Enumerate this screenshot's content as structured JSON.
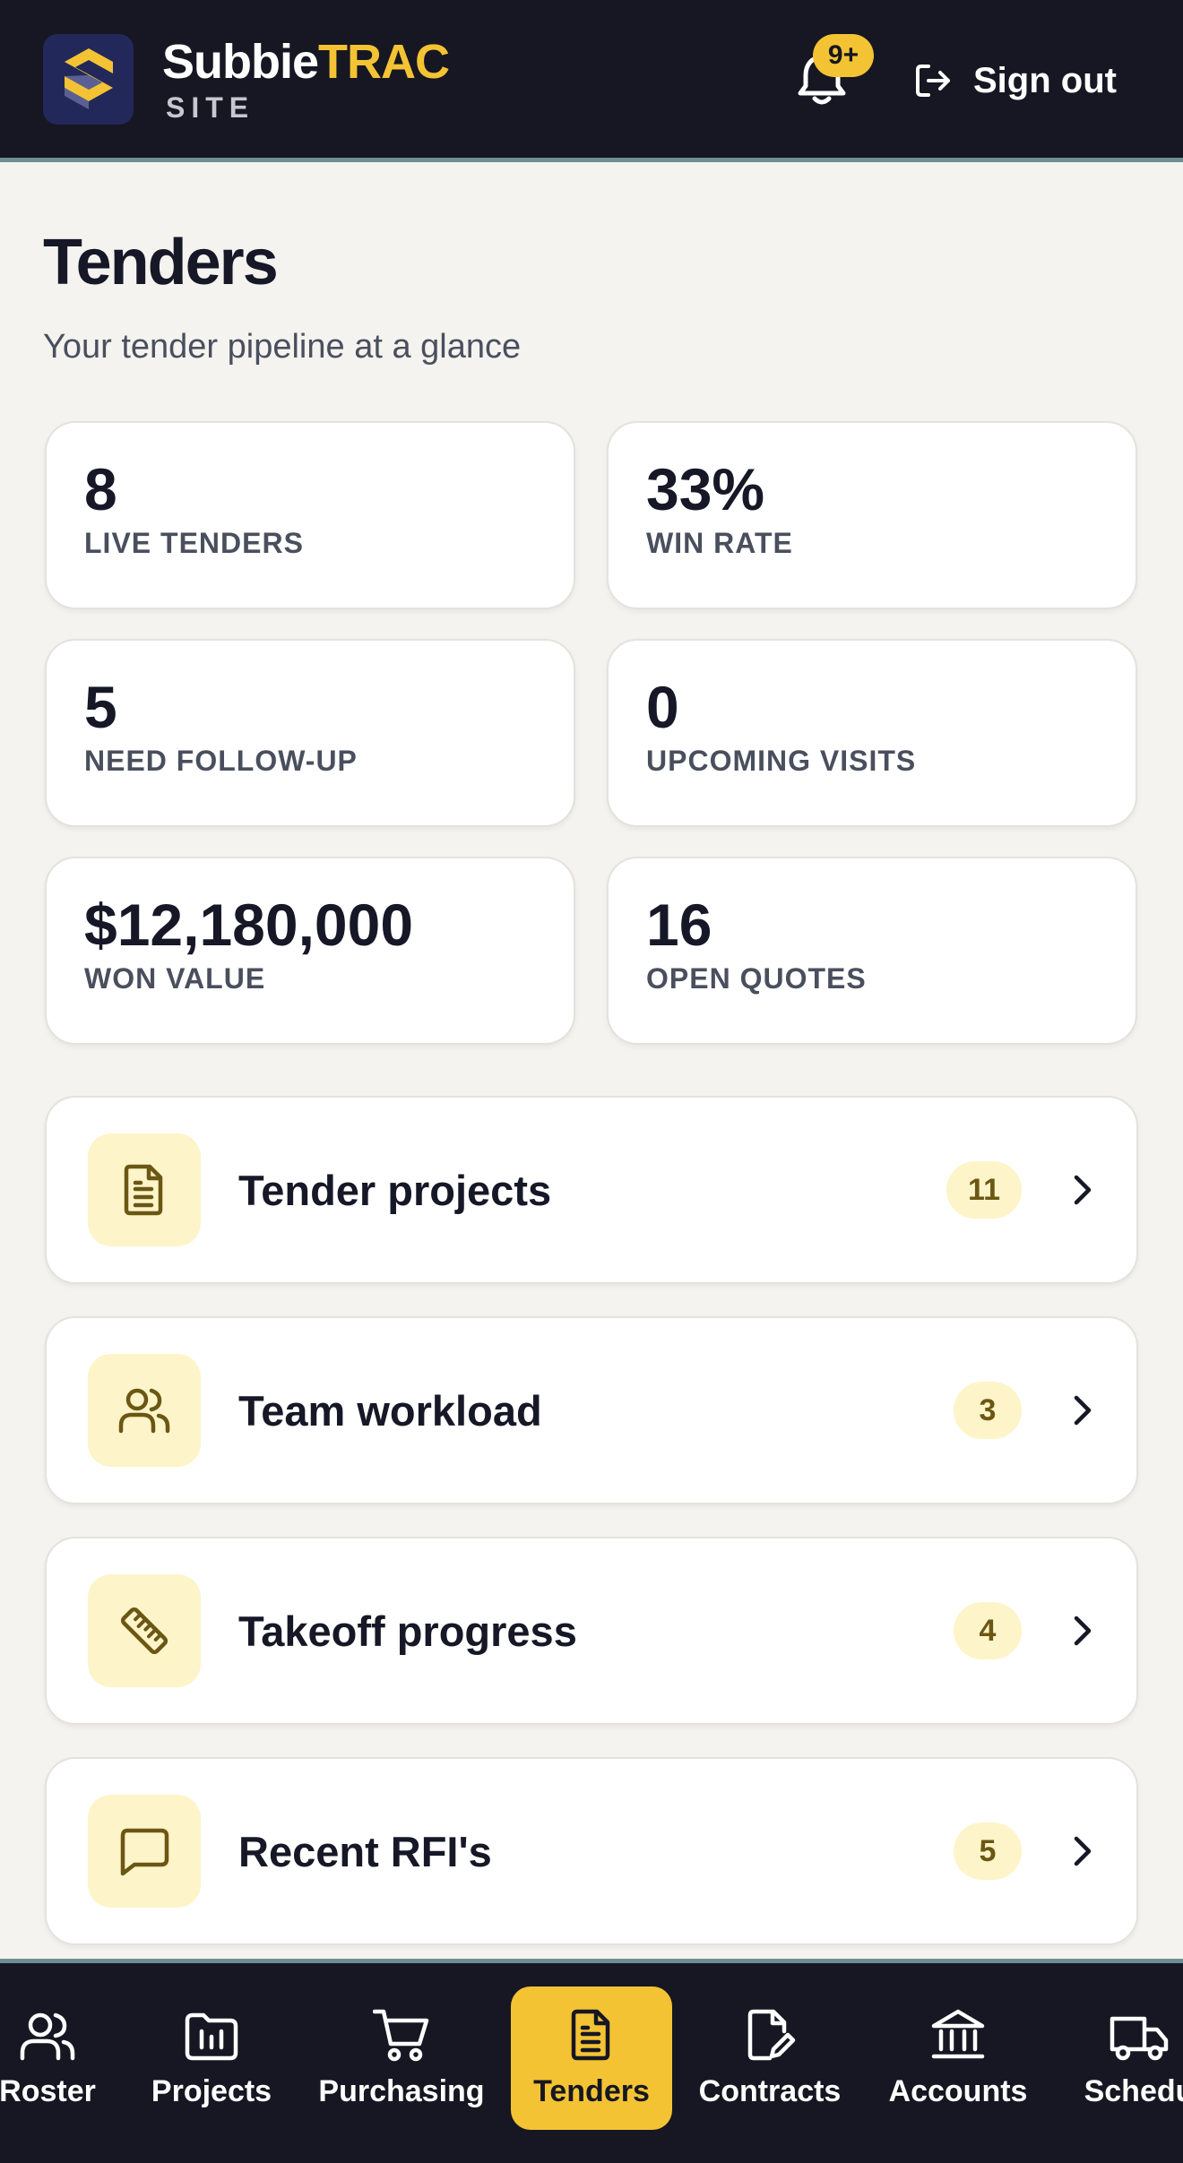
{
  "header": {
    "brand_part1": "Subbie",
    "brand_part2": "TRAC",
    "brand_sub": "SITE",
    "notifications_badge": "9+",
    "signout_label": "Sign out"
  },
  "page": {
    "title": "Tenders",
    "subtitle": "Your tender pipeline at a glance"
  },
  "stats": [
    {
      "value": "8",
      "label": "LIVE TENDERS"
    },
    {
      "value": "33%",
      "label": "WIN RATE"
    },
    {
      "value": "5",
      "label": "NEED FOLLOW-UP"
    },
    {
      "value": "0",
      "label": "UPCOMING VISITS"
    },
    {
      "value": "$12,180,000",
      "label": "WON VALUE"
    },
    {
      "value": "16",
      "label": "OPEN QUOTES"
    }
  ],
  "nav_cards": [
    {
      "label": "Tender projects",
      "count": "11",
      "icon": "document-icon"
    },
    {
      "label": "Team workload",
      "count": "3",
      "icon": "users-icon"
    },
    {
      "label": "Takeoff progress",
      "count": "4",
      "icon": "ruler-icon"
    },
    {
      "label": "Recent RFI's",
      "count": "5",
      "icon": "message-icon"
    }
  ],
  "bottom_nav": [
    {
      "label": "Roster",
      "icon": "users-icon",
      "active": false
    },
    {
      "label": "Projects",
      "icon": "folder-chart-icon",
      "active": false
    },
    {
      "label": "Purchasing",
      "icon": "cart-icon",
      "active": false
    },
    {
      "label": "Tenders",
      "icon": "document-icon",
      "active": true
    },
    {
      "label": "Contracts",
      "icon": "signed-document-icon",
      "active": false
    },
    {
      "label": "Accounts",
      "icon": "bank-icon",
      "active": false
    },
    {
      "label": "Schedu",
      "icon": "truck-icon",
      "active": false
    }
  ],
  "colors": {
    "header_bg": "#161722",
    "accent_yellow": "#f3c334",
    "page_bg": "#f4f3ef",
    "icon_tile_bg": "#fdf4c9",
    "divider_teal": "#6e8d94"
  }
}
